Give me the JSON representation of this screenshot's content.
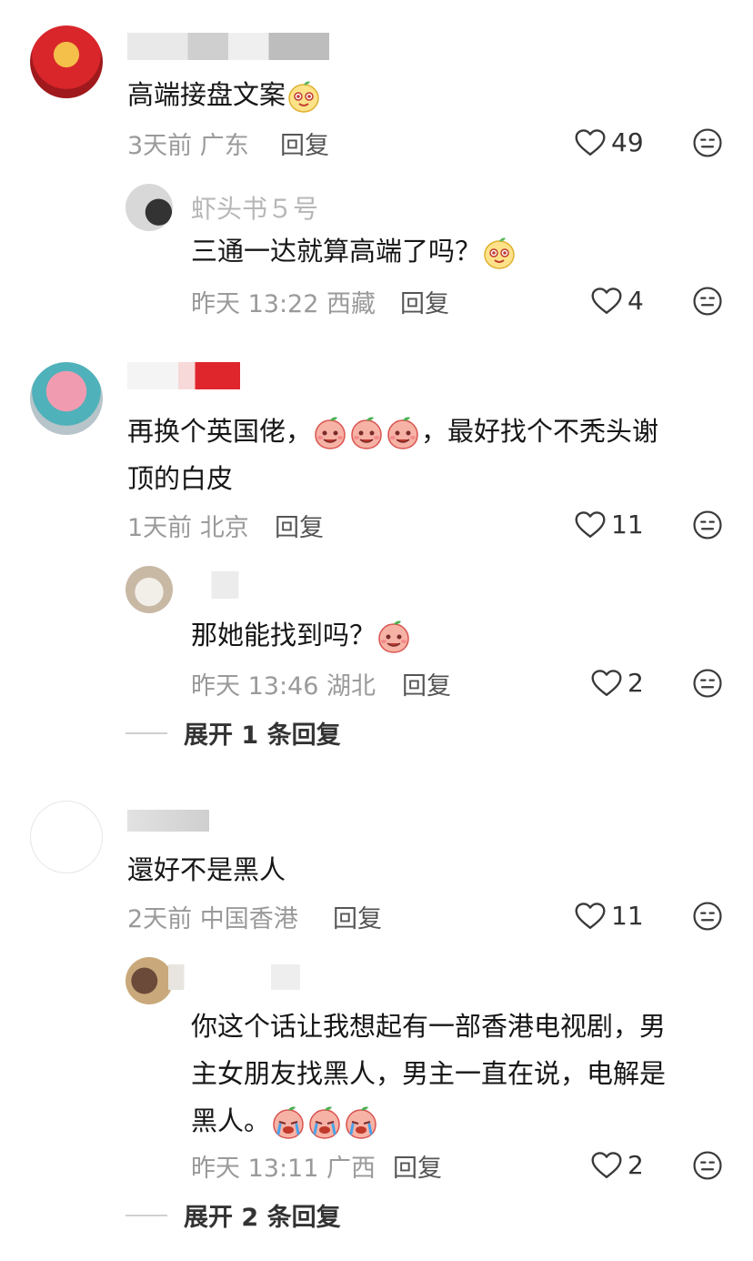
{
  "comments": [
    {
      "text": "高端接盘文案",
      "meta": "3天前 广东",
      "reply_label": "回复",
      "likes": "49",
      "reply": {
        "username": "虾头书５号",
        "text": "三通一达就算高端了吗？",
        "meta": "昨天 13:22 西藏",
        "reply_label": "回复",
        "likes": "4"
      }
    },
    {
      "text": "再换个英国佬，",
      "text2": "，最好找个不秃头谢",
      "text3": "顶的白皮",
      "meta": "1天前 北京",
      "reply_label": "回复",
      "likes": "11",
      "reply": {
        "text": "那她能找到吗？",
        "meta": "昨天 13:46 湖北",
        "reply_label": "回复",
        "likes": "2"
      },
      "expand_label": "展开 1 条回复"
    },
    {
      "text": "還好不是黑人",
      "meta": "2天前 中国香港",
      "reply_label": "回复",
      "likes": "11",
      "reply": {
        "text_line1": "你这个话让我想起有一部香港电视剧，男",
        "text_line2": "主女朋友找黑人，男主一直在说，电解是",
        "text_line3": "黑人。",
        "meta": "昨天 13:11 广西",
        "reply_label": "回复",
        "likes": "2"
      },
      "expand_label": "展开 2 条回复"
    }
  ],
  "colors": {
    "accent_red": "#e0262d",
    "meta_gray": "#9a9a9a"
  },
  "icons": [
    "heart-outline-icon",
    "face-neutral-icon",
    "peach-emoji",
    "fruit-emoji"
  ]
}
